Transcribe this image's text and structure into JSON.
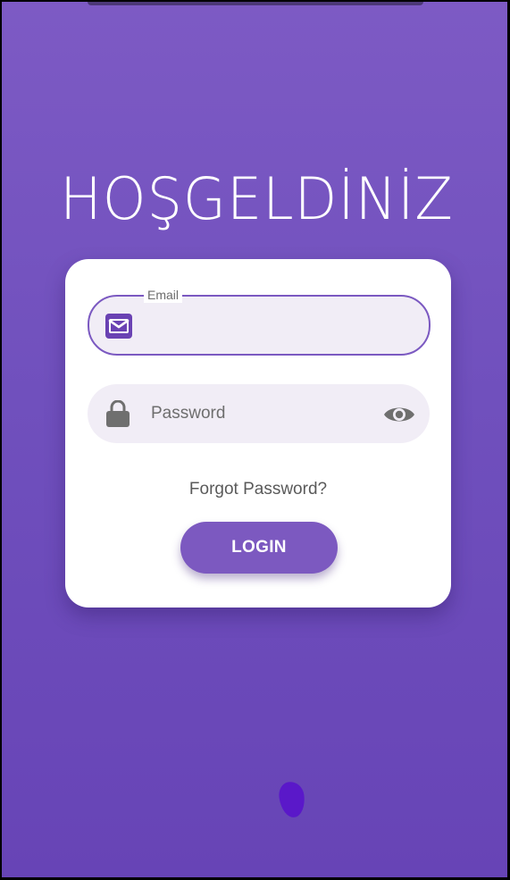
{
  "welcome_title": "HOŞGELDİNİZ",
  "login_form": {
    "email": {
      "label": "Email",
      "value": "",
      "icon": "mail-icon"
    },
    "password": {
      "placeholder": "Password",
      "value": "",
      "icon": "lock-icon",
      "toggle_icon": "eye-icon"
    },
    "forgot_password": "Forgot Password?",
    "login_button": "LOGIN"
  },
  "colors": {
    "background": "#7050bd",
    "accent": "#7c59c0",
    "card": "#ffffff",
    "field_fill": "#f1edf6",
    "icon_gray": "#6f6f6f"
  }
}
